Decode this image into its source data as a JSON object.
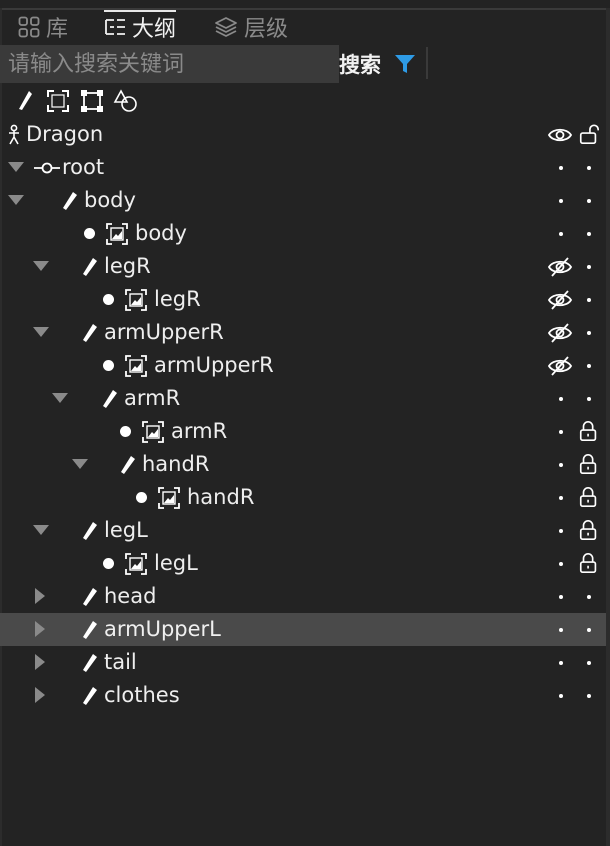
{
  "tabs": [
    {
      "label": "库",
      "icon": "grid-icon",
      "active": false
    },
    {
      "label": "大纲",
      "icon": "outline-list-icon",
      "active": true
    },
    {
      "label": "层级",
      "icon": "layers-icon",
      "active": false
    }
  ],
  "search": {
    "placeholder": "请输入搜索关键词",
    "value": "",
    "button_label": "搜索",
    "filter_icon": "filter-icon",
    "filter_color": "#2e9be6"
  },
  "toolbar": {
    "tools": [
      "bone-tool-icon",
      "fit-frame-icon",
      "select-box-icon",
      "shapes-icon"
    ]
  },
  "outline": {
    "selected_label": "armUpperL",
    "rows": [
      {
        "label": "Dragon",
        "type": "armature",
        "depth": 0,
        "expander": "none",
        "visibility": "visible",
        "lock": "unlocked"
      },
      {
        "label": "root",
        "type": "root",
        "depth": 0,
        "expander": "expanded",
        "visibility": "default",
        "lock": "default"
      },
      {
        "label": "body",
        "type": "bone",
        "depth": 1,
        "expander": "expanded",
        "visibility": "default",
        "lock": "default"
      },
      {
        "label": "body",
        "type": "slot",
        "depth": 2,
        "expander": "none",
        "visibility": "default",
        "lock": "default"
      },
      {
        "label": "legR",
        "type": "bone",
        "depth": 2,
        "expander": "expanded",
        "visibility": "hidden",
        "lock": "default"
      },
      {
        "label": "legR",
        "type": "slot",
        "depth": 3,
        "expander": "none",
        "visibility": "hidden",
        "lock": "default"
      },
      {
        "label": "armUpperR",
        "type": "bone",
        "depth": 2,
        "expander": "expanded",
        "visibility": "hidden",
        "lock": "default"
      },
      {
        "label": "armUpperR",
        "type": "slot",
        "depth": 3,
        "expander": "none",
        "visibility": "hidden",
        "lock": "default"
      },
      {
        "label": "armR",
        "type": "bone",
        "depth": 3,
        "expander": "expanded",
        "visibility": "default",
        "lock": "default"
      },
      {
        "label": "armR",
        "type": "slot",
        "depth": 4,
        "expander": "none",
        "visibility": "default",
        "lock": "locked"
      },
      {
        "label": "handR",
        "type": "bone",
        "depth": 4,
        "expander": "expanded",
        "visibility": "default",
        "lock": "locked"
      },
      {
        "label": "handR",
        "type": "slot",
        "depth": 5,
        "expander": "none",
        "visibility": "default",
        "lock": "locked"
      },
      {
        "label": "legL",
        "type": "bone",
        "depth": 2,
        "expander": "expanded",
        "visibility": "default",
        "lock": "locked"
      },
      {
        "label": "legL",
        "type": "slot",
        "depth": 3,
        "expander": "none",
        "visibility": "default",
        "lock": "locked"
      },
      {
        "label": "head",
        "type": "bone",
        "depth": 2,
        "expander": "collapsed",
        "visibility": "default",
        "lock": "default"
      },
      {
        "label": "armUpperL",
        "type": "bone",
        "depth": 2,
        "expander": "collapsed",
        "visibility": "default",
        "lock": "default"
      },
      {
        "label": "tail",
        "type": "bone",
        "depth": 2,
        "expander": "collapsed",
        "visibility": "default",
        "lock": "default"
      },
      {
        "label": "clothes",
        "type": "bone",
        "depth": 2,
        "expander": "collapsed",
        "visibility": "default",
        "lock": "default"
      }
    ]
  }
}
